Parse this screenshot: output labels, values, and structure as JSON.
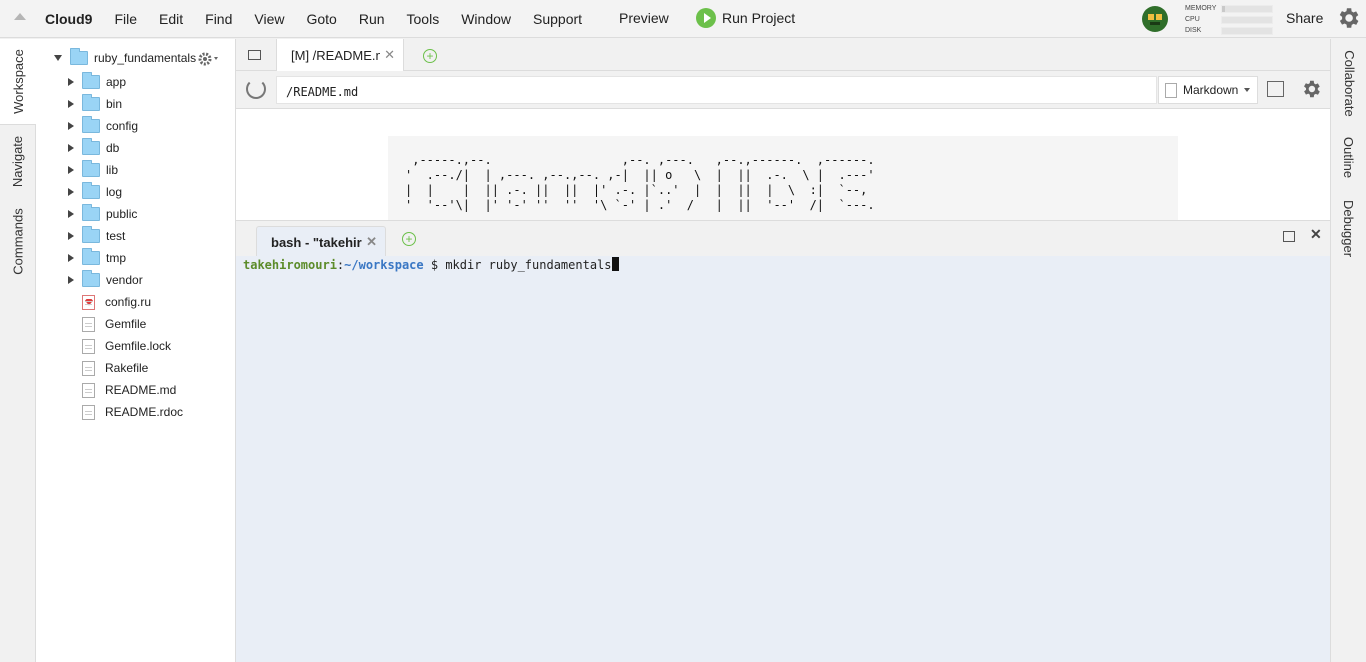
{
  "menubar": {
    "brand": "Cloud9",
    "items": [
      "File",
      "Edit",
      "Find",
      "View",
      "Goto",
      "Run",
      "Tools",
      "Window",
      "Support"
    ],
    "preview": "Preview",
    "run_project": "Run Project",
    "metrics": [
      {
        "label": "MEMORY",
        "level": 0.05
      },
      {
        "label": "CPU",
        "level": 0.0
      },
      {
        "label": "DISK",
        "level": 0.0
      }
    ],
    "share": "Share"
  },
  "left_rail": [
    "Workspace",
    "Navigate",
    "Commands"
  ],
  "right_rail": [
    "Collaborate",
    "Outline",
    "Debugger"
  ],
  "file_tree": {
    "root": "ruby_fundamentals",
    "folders": [
      "app",
      "bin",
      "config",
      "db",
      "lib",
      "log",
      "public",
      "test",
      "tmp",
      "vendor"
    ],
    "files": [
      {
        "name": "config.ru",
        "icon": "ruby-file-icon"
      },
      {
        "name": "Gemfile",
        "icon": "file-icon"
      },
      {
        "name": "Gemfile.lock",
        "icon": "file-icon"
      },
      {
        "name": "Rakefile",
        "icon": "file-icon"
      },
      {
        "name": "README.md",
        "icon": "file-icon"
      },
      {
        "name": "README.rdoc",
        "icon": "file-icon"
      }
    ]
  },
  "editor": {
    "tab_label": "[M] /README.md",
    "path": "/README.md",
    "mode": "Markdown",
    "ascii_art": " ,-----.,--.                  ,--. ,---.   ,--.,------.  ,------.\n'  .--./|  | ,---. ,--.,--. ,-|  || o   \\  |  ||  .-.  \\ |  .---'\n|  |    |  || .-. ||  ||  |' .-. |`..'  |  |  ||  |  \\  :|  `--,\n'  '--'\\|  |' '-' ''  ''  '\\ `-' | .'  /   |  ||  '--'  /|  `---."
  },
  "terminal": {
    "tab_label": "bash - \"takehiromouri@\"",
    "user": "takehiromouri",
    "sep": ":",
    "dir": "~/workspace",
    "prompt": " $ ",
    "command": "mkdir ruby_fundamentals"
  },
  "colors": {
    "accent_green": "#6cc04a",
    "folder_blue": "#9ad4f5",
    "terminal_bg": "#e9eef6",
    "user_green": "#5c8c2a",
    "dir_blue": "#3a77c4"
  }
}
